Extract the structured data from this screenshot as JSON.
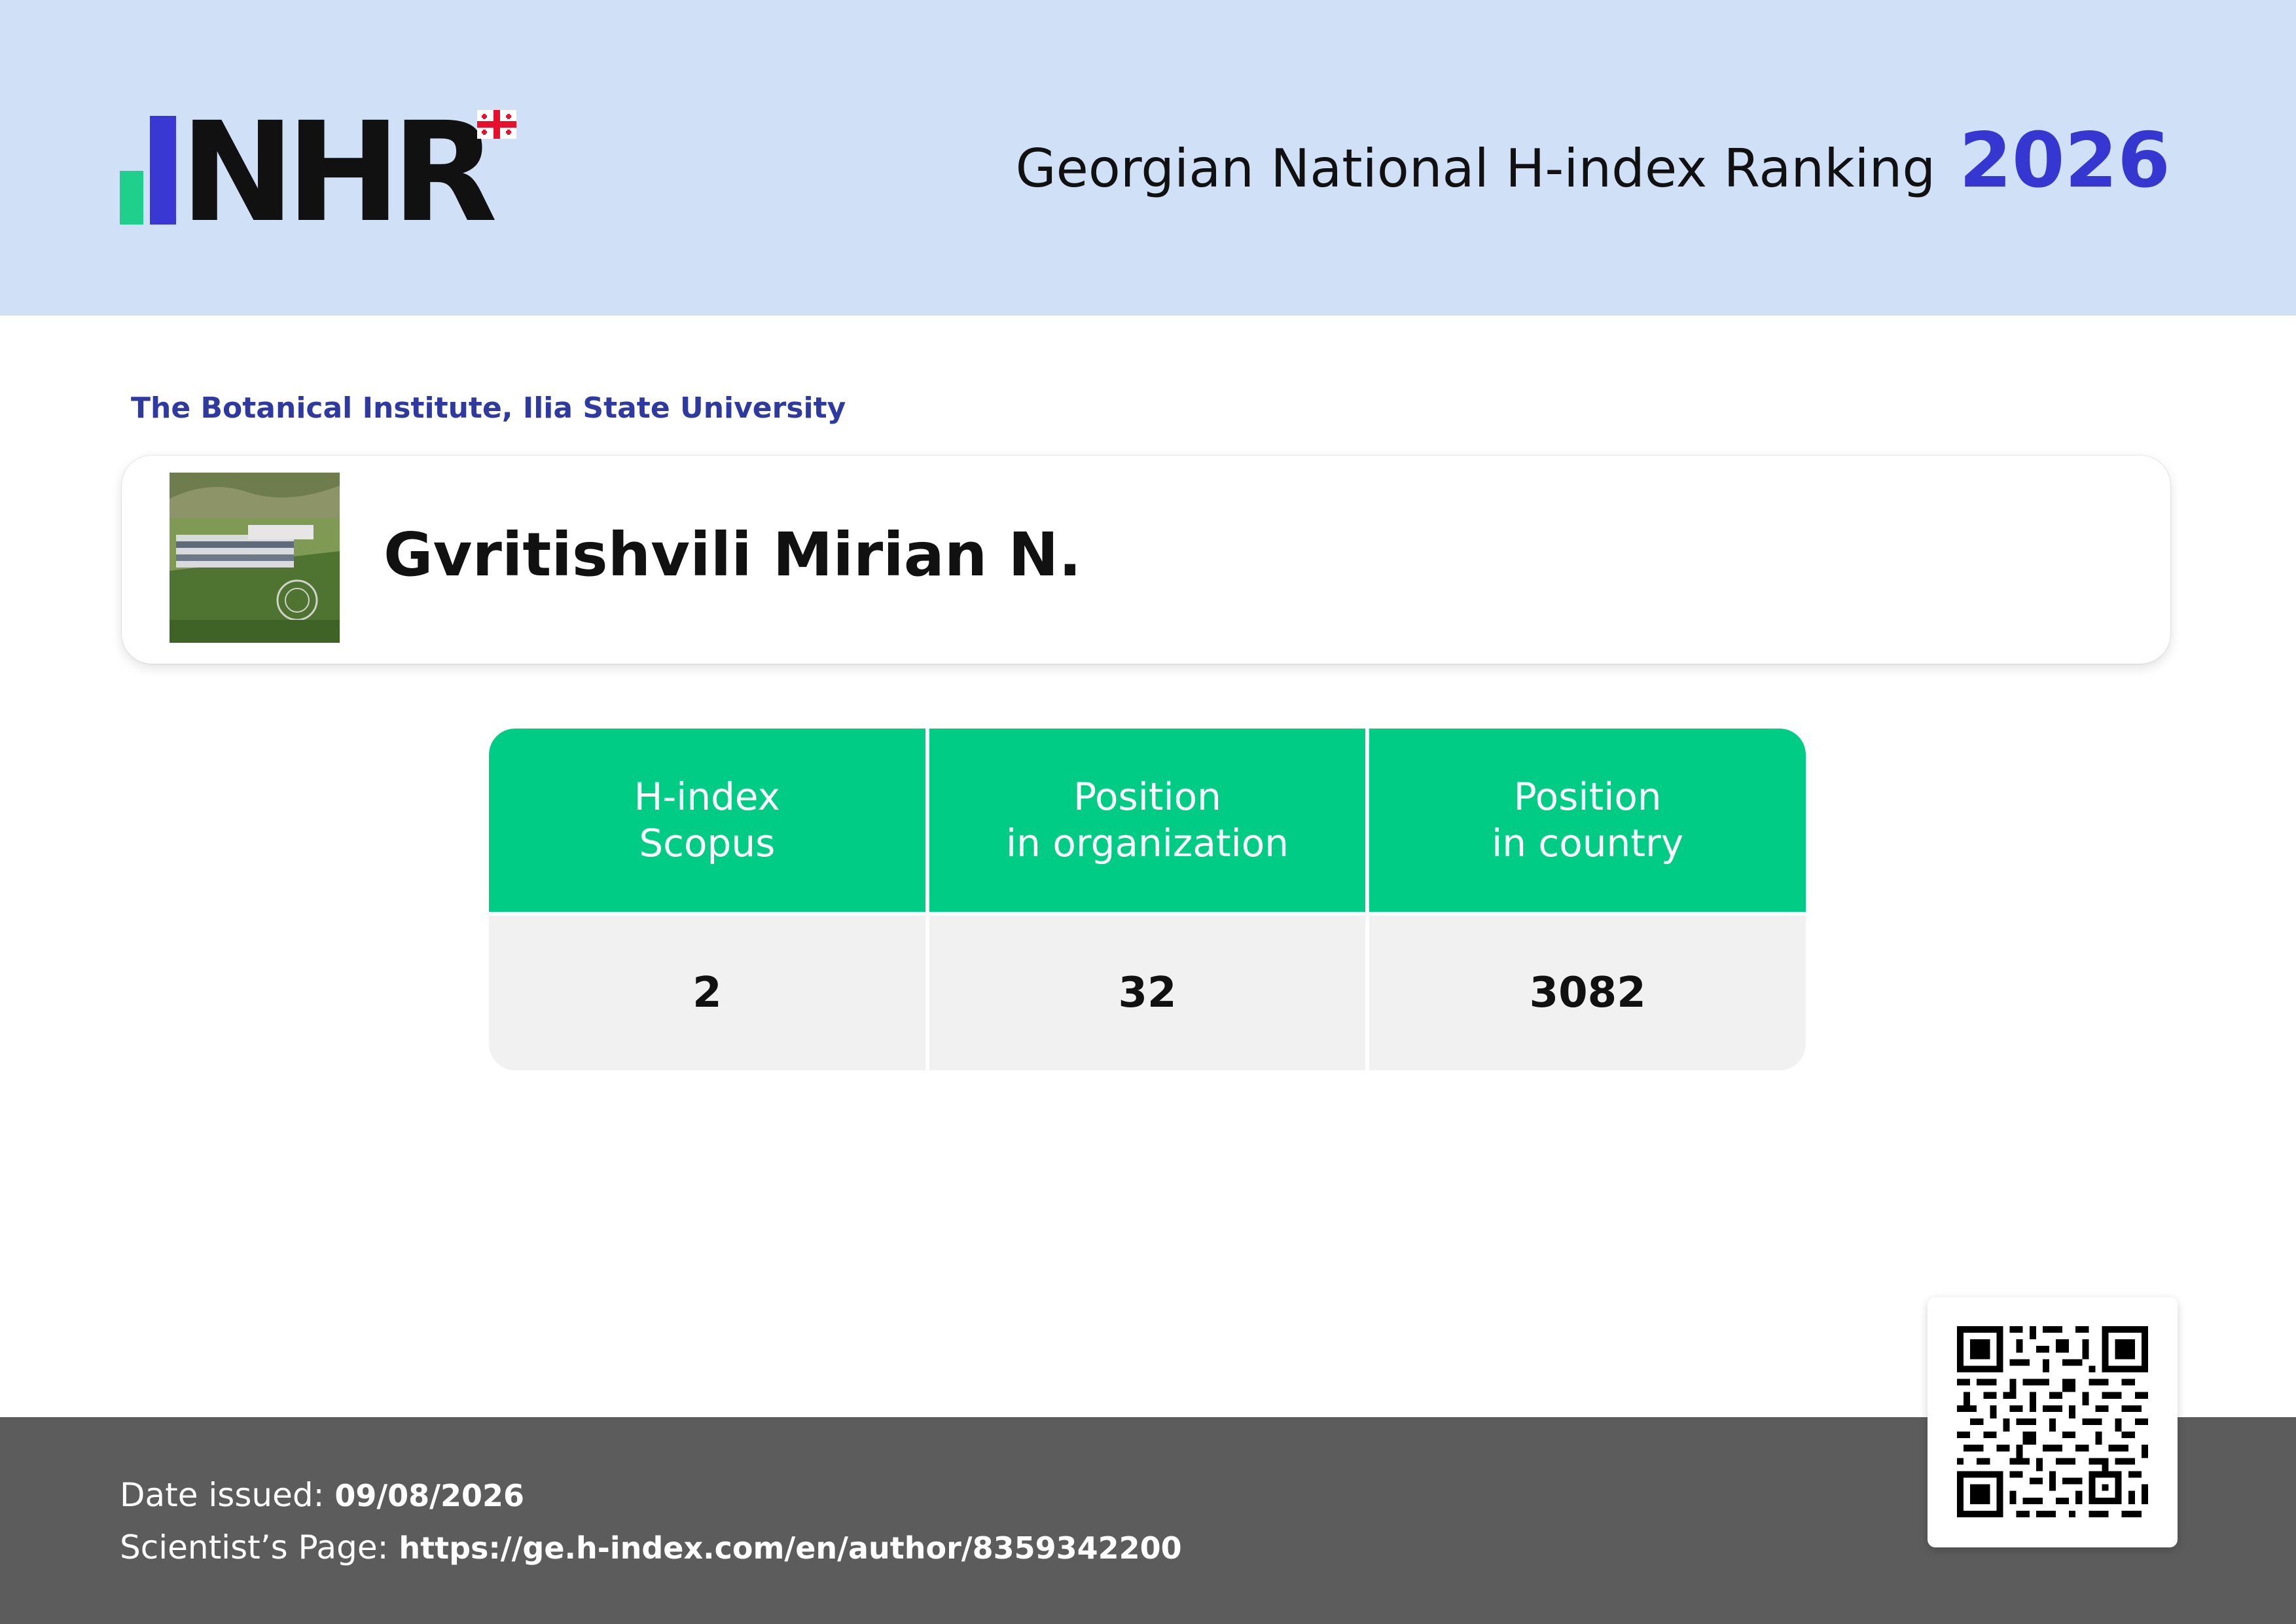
{
  "header": {
    "logo_text": "NHR",
    "title": "Georgian National H-index Ranking",
    "year": "2026"
  },
  "organization": "The Botanical Institute, Ilia State University",
  "scientist": {
    "name": "Gvritishvili Mirian N."
  },
  "stats": {
    "columns": [
      {
        "header_line1": "H-index",
        "header_line2": "Scopus",
        "value": "2"
      },
      {
        "header_line1": "Position",
        "header_line2": "in organization",
        "value": "32"
      },
      {
        "header_line1": "Position",
        "header_line2": "in country",
        "value": "3082"
      }
    ]
  },
  "footer": {
    "date_label": "Date issued:",
    "date_value": "09/08/2026",
    "page_label": "Scientist’s Page:",
    "page_url": "https://ge.h-index.com/en/author/8359342200"
  },
  "colors": {
    "header_bg": "#cfe0f7",
    "accent_blue": "#3637d0",
    "accent_green": "#00cc86",
    "footer_bg": "#5c5c5c"
  }
}
